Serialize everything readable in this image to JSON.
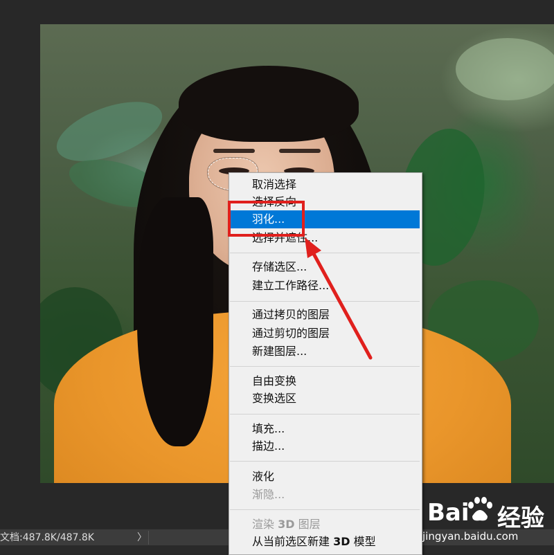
{
  "context_menu": {
    "items": [
      {
        "label": "取消选择",
        "state": "normal"
      },
      {
        "label": "选择反向",
        "state": "normal"
      },
      {
        "label": "羽化...",
        "state": "highlighted"
      },
      {
        "label": "选择并遮住...",
        "state": "normal"
      },
      {
        "label": "存储选区...",
        "state": "normal"
      },
      {
        "label": "建立工作路径...",
        "state": "normal"
      },
      {
        "label": "通过拷贝的图层",
        "state": "normal"
      },
      {
        "label": "通过剪切的图层",
        "state": "normal"
      },
      {
        "label": "新建图层...",
        "state": "normal"
      },
      {
        "label": "自由变换",
        "state": "normal"
      },
      {
        "label": "变换选区",
        "state": "normal"
      },
      {
        "label": "填充...",
        "state": "normal"
      },
      {
        "label": "描边...",
        "state": "normal"
      },
      {
        "label": "液化",
        "state": "normal"
      },
      {
        "label": "渐隐...",
        "state": "disabled"
      },
      {
        "label_pre": "渲染 ",
        "label_bold": "3D",
        "label_post": " 图层",
        "state": "disabled"
      },
      {
        "label_pre": "从当前选区新建 ",
        "label_bold": "3D",
        "label_post": " 模型",
        "state": "normal"
      }
    ]
  },
  "status_bar": {
    "doc_info": "文档:487.8K/487.8K",
    "arrow": "〉"
  },
  "watermark": {
    "logo_left": "Bai",
    "logo_right": "经验",
    "site": "jingyan.baidu.com"
  },
  "colors": {
    "menu_highlight": "#0078d7",
    "annotation_red": "#e0201d",
    "workspace_bg": "#282828"
  }
}
